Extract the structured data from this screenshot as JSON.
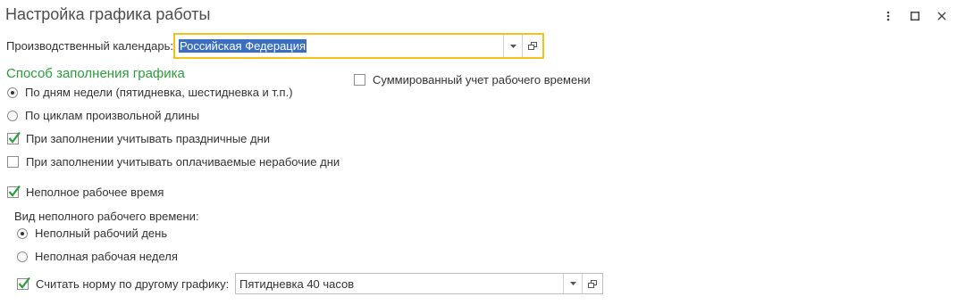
{
  "window": {
    "title": "Настройка графика работы",
    "menu_icon": "more-vertical-icon",
    "maximize_icon": "maximize-icon",
    "close_icon": "close-icon"
  },
  "calendar": {
    "label": "Производственный календарь:",
    "value": "Российская Федерация",
    "focus_color": "#f2c31a",
    "selection_color": "#3a6ec0"
  },
  "fill_method": {
    "heading": "Способ заполнения графика",
    "heading_color": "#2a9d3c",
    "options": [
      {
        "label": "По дням недели (пятидневка, шестидневка и т.п.)",
        "selected": true
      },
      {
        "label": "По циклам произвольной длины",
        "selected": false
      }
    ]
  },
  "summary_accounting": {
    "label": "Суммированный учет рабочего времени",
    "checked": false
  },
  "consider_holidays": {
    "label": "При заполнении учитывать праздничные дни",
    "checked": true
  },
  "consider_paid_nonworking": {
    "label": "При заполнении учитывать оплачиваемые нерабочие дни",
    "checked": false
  },
  "part_time": {
    "label": "Неполное рабочее время",
    "checked": true,
    "type_label": "Вид неполного рабочего времени:",
    "options": [
      {
        "label": "Неполный рабочий день",
        "selected": true
      },
      {
        "label": "Неполная рабочая неделя",
        "selected": false
      }
    ],
    "norm": {
      "label": "Считать норму по другому графику:",
      "checked": true,
      "value": "Пятидневка 40 часов"
    }
  }
}
